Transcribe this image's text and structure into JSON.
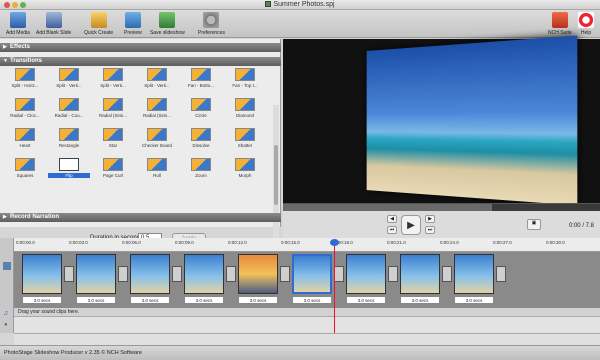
{
  "window": {
    "title": "Summer Photos.spj"
  },
  "toolbar": {
    "left": [
      {
        "label": "Add Media",
        "icon": "add-media-icon"
      },
      {
        "label": "Add Blank Slide",
        "icon": "add-blank-slide-icon"
      },
      {
        "label": "Quick Create",
        "icon": "quick-create-icon"
      },
      {
        "label": "Preview",
        "icon": "preview-icon"
      },
      {
        "label": "Save slideshow",
        "icon": "save-slideshow-icon"
      },
      {
        "label": "Preferences",
        "icon": "preferences-icon"
      }
    ],
    "right": [
      {
        "label": "NCH Suite",
        "icon": "nch-suite-icon"
      },
      {
        "label": "Help",
        "icon": "help-icon"
      }
    ]
  },
  "panels": {
    "effects": "Effects",
    "transitions": "Transitions",
    "record": "Record Narration"
  },
  "transitions": [
    "Split - Horiz...",
    "Split - Verti...",
    "Split - Verti...",
    "Split - Verti...",
    "Fan - Botto...",
    "Fan - Top t...",
    "Radial - Cloc...",
    "Radial - Cou...",
    "Radial (Simi...",
    "Radial (Simi...",
    "Circle",
    "Diamond",
    "Heart",
    "Rectangle",
    "Star",
    "Checker Board",
    "Dissolve",
    "Shatter",
    "Squares",
    "Flip",
    "Page Curl",
    "Roll",
    "Zoom",
    "Morph"
  ],
  "selected_transition_index": 19,
  "duration": {
    "label": "Duration in seconds:",
    "value": "0.5",
    "apply": "Apply"
  },
  "player": {
    "time": "0:00 / 7.8",
    "progress": 0.66
  },
  "timeline": {
    "ticks": [
      "0:00:00.0",
      "0:00:03.0",
      "0:00:06.0",
      "0:00:09.0",
      "0:00:12.0",
      "0:00:15.0",
      "0:00:18.0",
      "0:00:21.0",
      "0:00:24.0",
      "0:00:27.0",
      "0:00:30.0"
    ],
    "slides": [
      {
        "dur": "3.0 secs",
        "style": "beach"
      },
      {
        "dur": "3.0 secs",
        "style": "beach"
      },
      {
        "dur": "3.0 secs",
        "style": "beach"
      },
      {
        "dur": "3.0 secs",
        "style": "beach"
      },
      {
        "dur": "3.0 secs",
        "style": "sunset"
      },
      {
        "dur": "3.0 secs",
        "style": "beach",
        "selected": true
      },
      {
        "dur": "3.0 secs",
        "style": "beach"
      },
      {
        "dur": "3.0 secs",
        "style": "beach"
      },
      {
        "dur": "3.0 secs",
        "style": "beach"
      }
    ],
    "audio_hint": "Drag your sound clips here."
  },
  "status": "PhotoStage Slideshow Producer v 2.35 © NCH Software"
}
